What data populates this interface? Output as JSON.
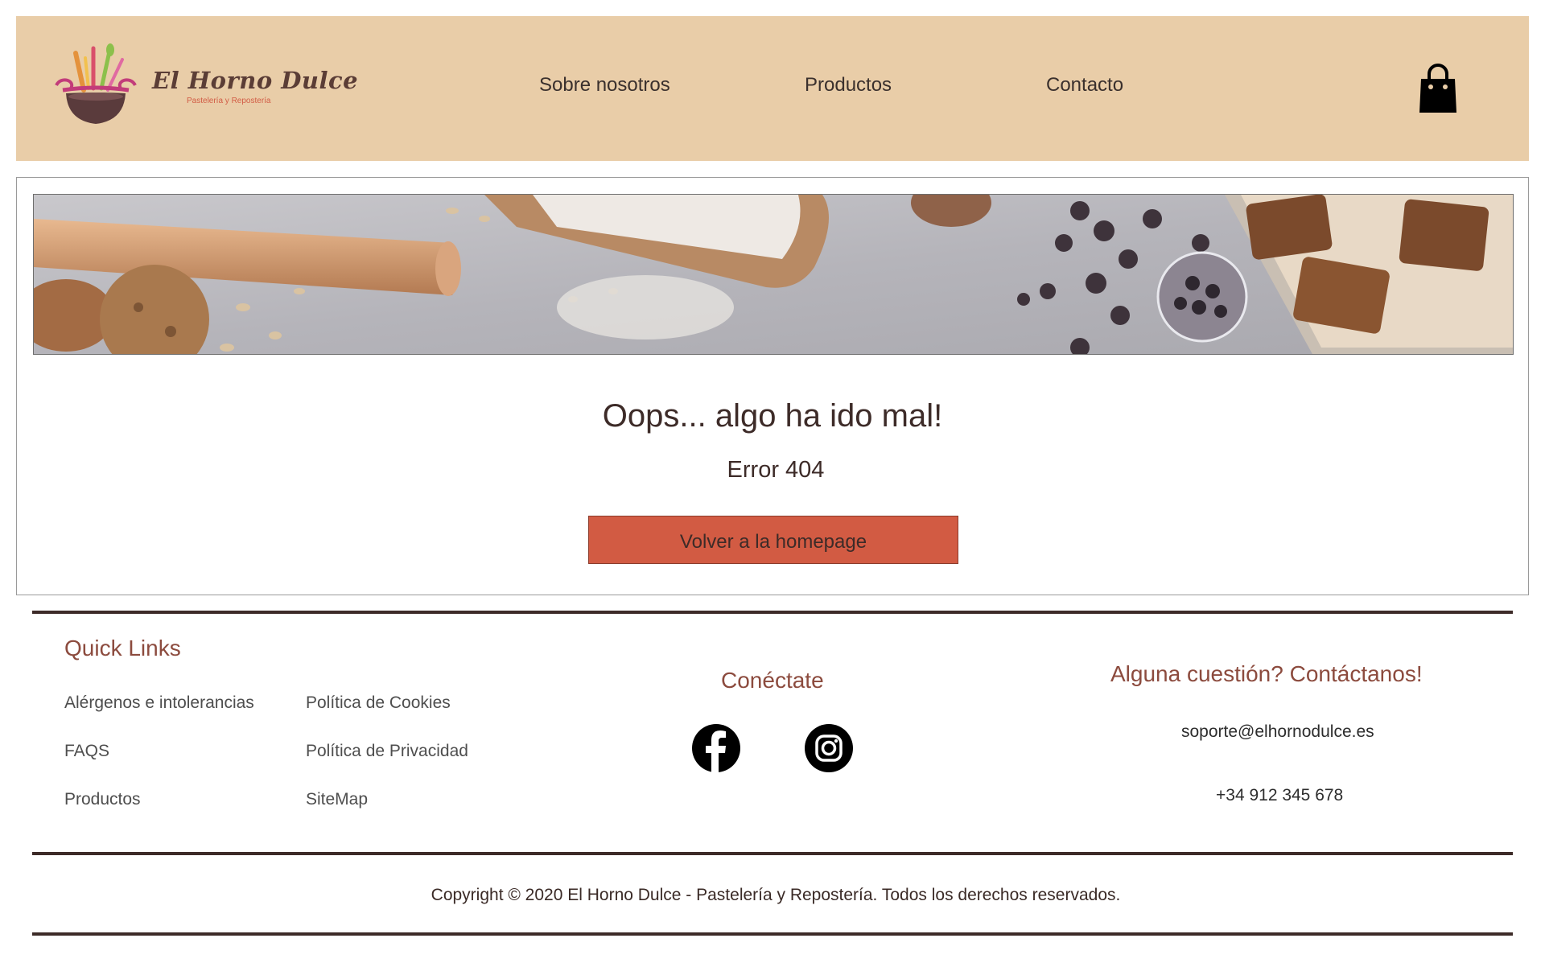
{
  "header": {
    "logo": {
      "title": "El Horno Dulce",
      "subtitle": "Pastelería y Repostería"
    },
    "nav": [
      {
        "label": "Sobre nosotros"
      },
      {
        "label": "Productos"
      },
      {
        "label": "Contacto"
      }
    ],
    "cart_icon": "shopping-bag-icon"
  },
  "main": {
    "hero_alt": "",
    "error_title": "Oops... algo ha ido mal!",
    "error_code": "Error 404",
    "home_button": "Volver a la homepage"
  },
  "footer": {
    "quick_links": {
      "heading": "Quick Links",
      "col1": [
        "Alérgenos e intolerancias",
        "FAQS",
        "Productos"
      ],
      "col2": [
        "Política de Cookies",
        "Política de Privacidad",
        "SiteMap"
      ]
    },
    "social": {
      "heading": "Conéctate",
      "icons": [
        "facebook-icon",
        "instagram-icon"
      ]
    },
    "contact": {
      "heading": "Alguna cuestión? Contáctanos!",
      "email": "soporte@elhornodulce.es",
      "phone": "+34 912 345 678"
    },
    "copyright": "Copyright © 2020 El Horno Dulce - Pastelería y Repostería. Todos los derechos reservados."
  },
  "colors": {
    "header_bg": "#e9cda8",
    "accent": "#d25b43",
    "heading": "#8c4b3e",
    "text_dark": "#3d2b28"
  }
}
